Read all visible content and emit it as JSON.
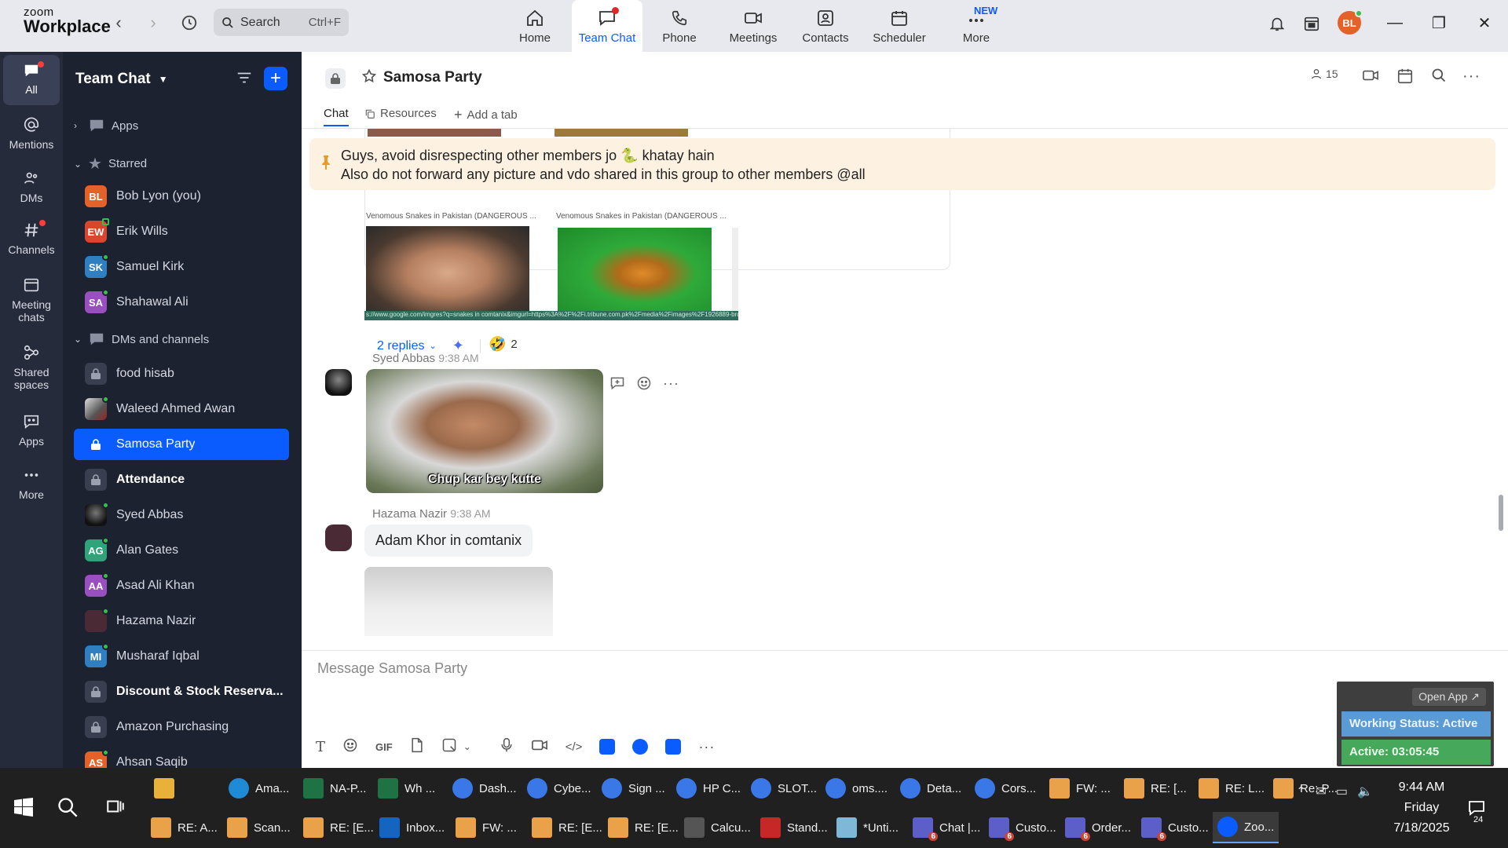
{
  "app": {
    "logo_line1": "zoom",
    "logo_line2": "Workplace"
  },
  "search": {
    "label": "Search",
    "shortcut": "Ctrl+F"
  },
  "top_tabs": [
    {
      "label": "Home",
      "icon": "home-icon"
    },
    {
      "label": "Team Chat",
      "icon": "chat-icon",
      "active": true
    },
    {
      "label": "Phone",
      "icon": "phone-icon"
    },
    {
      "label": "Meetings",
      "icon": "video-icon"
    },
    {
      "label": "Contacts",
      "icon": "contacts-icon"
    },
    {
      "label": "Scheduler",
      "icon": "calendar-icon"
    },
    {
      "label": "More",
      "icon": "more-icon",
      "badge": "NEW"
    }
  ],
  "user_avatar_initials": "BL",
  "rail": [
    {
      "label": "All",
      "active": true
    },
    {
      "label": "Mentions"
    },
    {
      "label": "DMs"
    },
    {
      "label": "Channels"
    },
    {
      "label": "Meeting chats"
    },
    {
      "label": "Shared spaces"
    },
    {
      "label": "Apps"
    },
    {
      "label": "More"
    }
  ],
  "sidebar": {
    "title": "Team Chat",
    "sections": {
      "apps": "Apps",
      "starred": "Starred",
      "dms": "DMs and channels"
    },
    "starred": [
      {
        "initials": "BL",
        "name": "Bob Lyon (you)",
        "color": "#e4612a"
      },
      {
        "initials": "EW",
        "name": "Erik Wills",
        "color": "#d9452f"
      },
      {
        "initials": "SK",
        "name": "Samuel Kirk",
        "color": "#2f7fc1"
      },
      {
        "initials": "SA",
        "name": "Shahawal Ali",
        "color": "#9a4fc1"
      }
    ],
    "channels": [
      {
        "type": "lock",
        "name": "food hisab"
      },
      {
        "type": "photo",
        "name": "Waleed Ahmed Awan"
      },
      {
        "type": "lock",
        "name": "Samosa Party",
        "active": true
      },
      {
        "type": "lock",
        "name": "Attendance",
        "bold": true
      },
      {
        "type": "photo",
        "name": "Syed Abbas"
      },
      {
        "type": "initials",
        "initials": "AG",
        "name": "Alan Gates",
        "color": "#2fa37a"
      },
      {
        "type": "initials",
        "initials": "AA",
        "name": "Asad Ali Khan",
        "color": "#9a4fc1"
      },
      {
        "type": "photo2",
        "name": "Hazama Nazir"
      },
      {
        "type": "initials",
        "initials": "MI",
        "name": "Musharaf Iqbal",
        "color": "#2f7fc1"
      },
      {
        "type": "lock",
        "name": "Discount & Stock Reserva...",
        "bold": true
      },
      {
        "type": "lock",
        "name": "Amazon Purchasing"
      },
      {
        "type": "initials",
        "initials": "AS",
        "name": "Ahsan Saqib",
        "color": "#e4612a"
      }
    ]
  },
  "channel": {
    "title": "Samosa Party",
    "member_count": "15",
    "tabs": {
      "chat": "Chat",
      "resources": "Resources",
      "add": "Add a tab"
    }
  },
  "pinned": {
    "line1": "Guys, avoid disrespecting other members jo 🐍 khatay hain",
    "line2": "Also do not forward any picture and vdo shared in this group to other members @all"
  },
  "messages": {
    "thumb_caption": "Venomous Snakes in Pakistan (DANGEROUS ...",
    "url_text": "s://www.google.com/imgres?q=snakes in comtanix&imgurl=https%3A%2F%2Fi.tribune.com.pk%2Fmedia%2Fimages%2F1926889-bro",
    "replies": "2 replies",
    "reaction_count": "2",
    "msg1": {
      "sender": "Syed Abbas",
      "time": "9:38 AM",
      "meme_caption": "Chup kar bey kutte"
    },
    "msg2": {
      "sender": "Hazama Nazir",
      "time": "9:38 AM",
      "text": "Adam Khor in comtanix"
    }
  },
  "composer": {
    "placeholder": "Message Samosa Party"
  },
  "working_status": {
    "open_app": "Open App ↗",
    "status": "Working Status: Active",
    "timer": "Active: 03:05:45"
  },
  "taskbar": {
    "row1": [
      {
        "label": "",
        "icon": "folder",
        "color": "#e8b23a"
      },
      {
        "label": "Ama...",
        "icon": "edge",
        "color": "#1f8bd6"
      },
      {
        "label": "NA-P...",
        "icon": "excel",
        "color": "#1f7244"
      },
      {
        "label": "Wh ...",
        "icon": "excel",
        "color": "#1f7244"
      },
      {
        "label": "Dash...",
        "icon": "chrome",
        "color": "#3b78e7"
      },
      {
        "label": "Cybe...",
        "icon": "chrome",
        "color": "#3b78e7"
      },
      {
        "label": "Sign ...",
        "icon": "chrome",
        "color": "#3b78e7"
      },
      {
        "label": "HP C...",
        "icon": "chrome",
        "color": "#3b78e7"
      },
      {
        "label": "SLOT...",
        "icon": "chrome",
        "color": "#3b78e7"
      },
      {
        "label": "oms....",
        "icon": "chrome",
        "color": "#3b78e7"
      },
      {
        "label": "Deta...",
        "icon": "chrome",
        "color": "#3b78e7"
      },
      {
        "label": "Cors...",
        "icon": "chrome",
        "color": "#3b78e7"
      },
      {
        "label": "FW: ...",
        "icon": "mail",
        "color": "#e9a14a"
      },
      {
        "label": "RE: [...",
        "icon": "mail",
        "color": "#e9a14a"
      },
      {
        "label": "RE: L...",
        "icon": "mail",
        "color": "#e9a14a"
      },
      {
        "label": "Re: P...",
        "icon": "mail",
        "color": "#e9a14a"
      }
    ],
    "row2": [
      {
        "label": "RE: A...",
        "icon": "mail",
        "color": "#e9a14a"
      },
      {
        "label": "Scan...",
        "icon": "mail",
        "color": "#e9a14a"
      },
      {
        "label": "RE: [E...",
        "icon": "mail",
        "color": "#e9a14a"
      },
      {
        "label": "Inbox...",
        "icon": "outlook",
        "color": "#1565c0"
      },
      {
        "label": "FW: ...",
        "icon": "mail",
        "color": "#e9a14a"
      },
      {
        "label": "RE: [E...",
        "icon": "mail",
        "color": "#e9a14a"
      },
      {
        "label": "RE: [E...",
        "icon": "mail",
        "color": "#e9a14a"
      },
      {
        "label": "Calcu...",
        "icon": "calc",
        "color": "#555"
      },
      {
        "label": "Stand...",
        "icon": "pdf",
        "color": "#c62828"
      },
      {
        "label": "*Unti...",
        "icon": "notepad",
        "color": "#7fb7d9"
      },
      {
        "label": "Chat |...",
        "icon": "teams",
        "color": "#5b5fc7",
        "badge": "6"
      },
      {
        "label": "Custo...",
        "icon": "teams",
        "color": "#5b5fc7",
        "badge": "6"
      },
      {
        "label": "Order...",
        "icon": "teams",
        "color": "#5b5fc7",
        "badge": "6"
      },
      {
        "label": "Custo...",
        "icon": "teams",
        "color": "#5b5fc7",
        "badge": "6"
      },
      {
        "label": "Zoo...",
        "icon": "zoom",
        "color": "#0b5cff",
        "active": true
      }
    ],
    "time": "9:44 AM",
    "day": "Friday",
    "date": "7/18/2025",
    "notifications": "24"
  }
}
